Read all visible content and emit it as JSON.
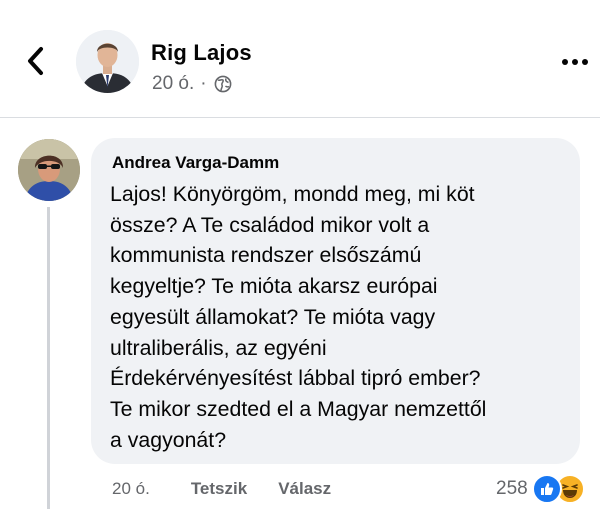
{
  "header": {
    "author_name": "Rig Lajos",
    "post_time": "20 ó.",
    "separator": "·",
    "back_icon": "chevron-left-icon",
    "audience_icon": "globe-icon",
    "more_icon": "more-horizontal-icon"
  },
  "comment": {
    "author": "Andrea Varga-Damm",
    "text": "Lajos! Könyörgöm, mondd meg, mi köt\nössze? A Te családod mikor volt a\nkommunista rendszer elsőszámú\nkegyeltje? Te mióta akarsz európai\negyesült államokat? Te mióta vagy\nultraliberális, az egyéni\nÉrdekérvényesítést lábbal  tipró ember?\nTe mikor szedted el a Magyar nemzettől\na vagyonát?",
    "time": "20 ó.",
    "like_label": "Tetszik",
    "reply_label": "Válasz",
    "reaction_count": "258",
    "reactions": [
      "like-reaction-icon",
      "haha-reaction-icon"
    ]
  },
  "colors": {
    "bubble": "#f0f2f5",
    "secondary_text": "#65676b",
    "like_blue": "#1877f2",
    "haha_yellow": "#f7b125"
  }
}
